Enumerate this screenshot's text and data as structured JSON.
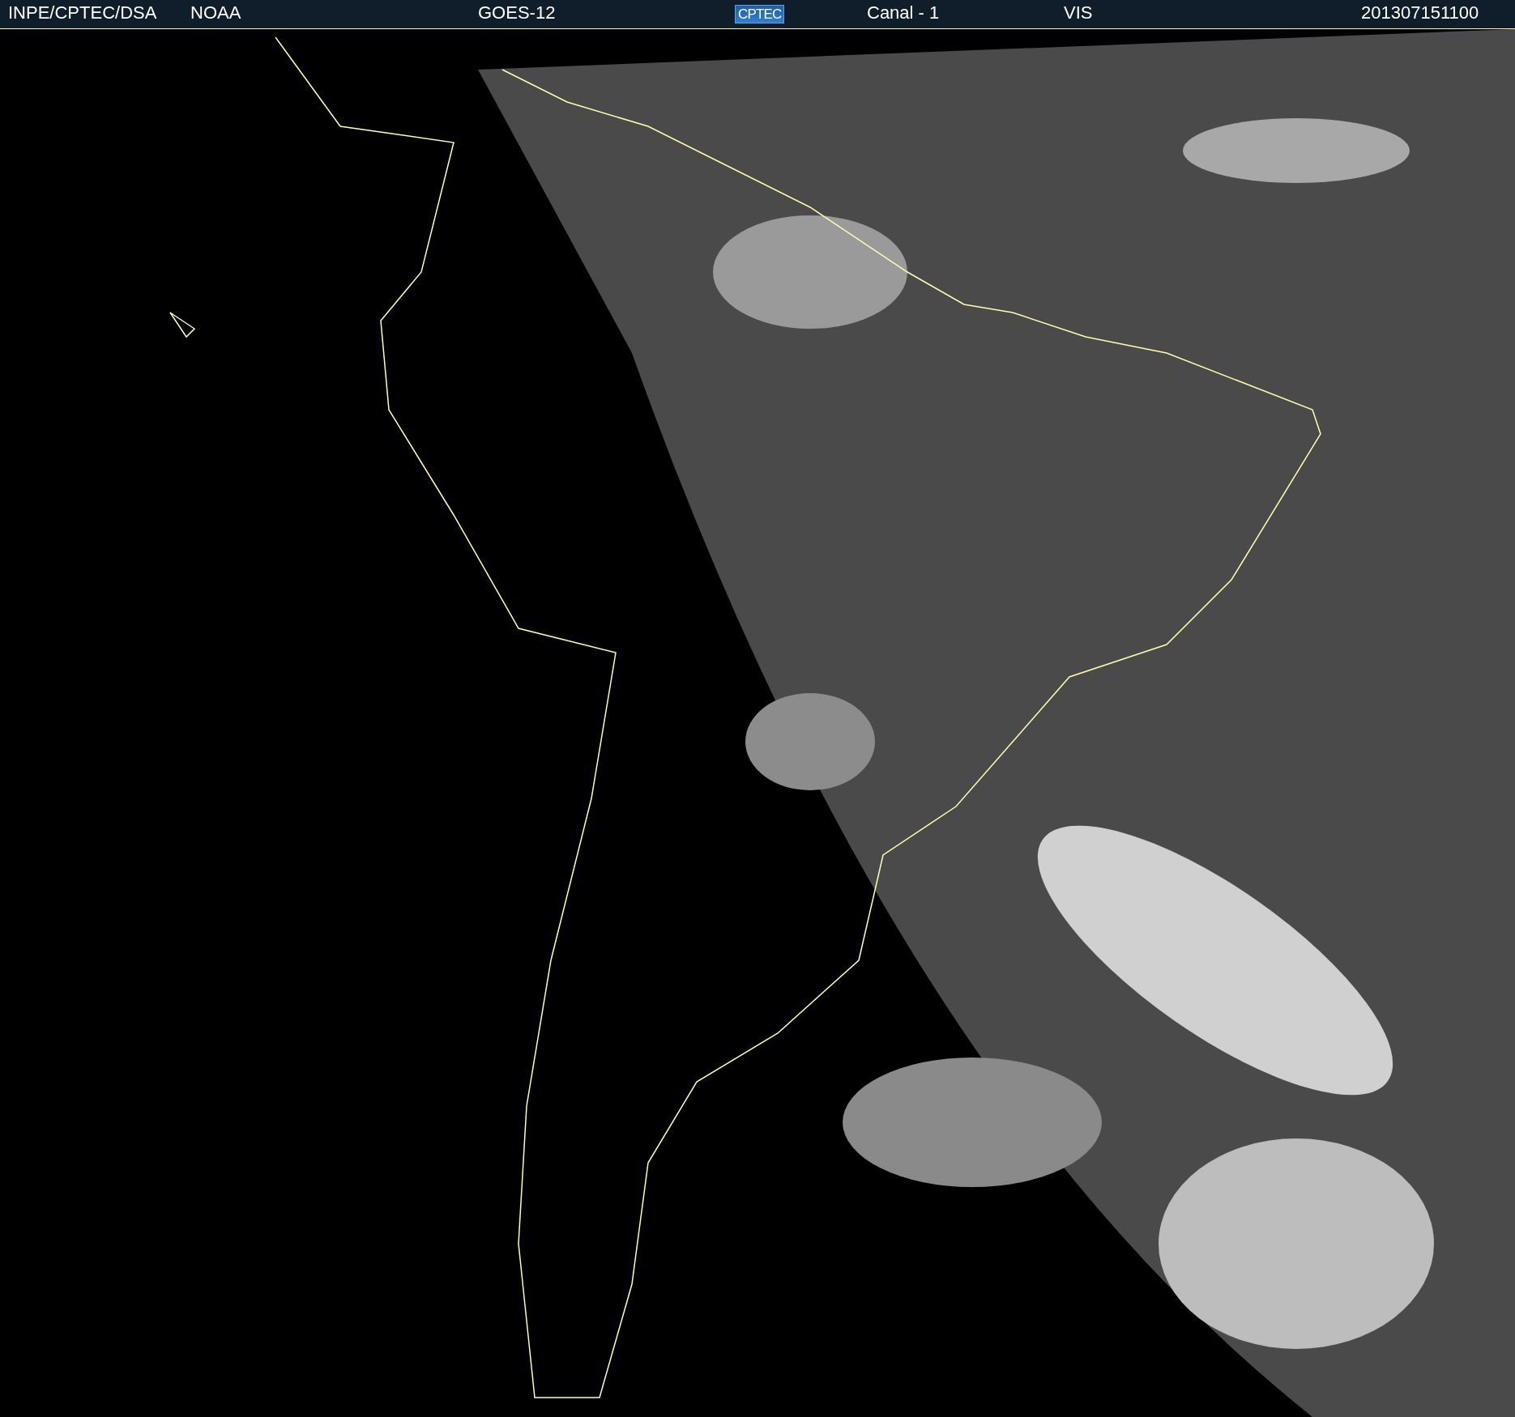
{
  "header": {
    "items": [
      {
        "kind": "text",
        "label": "INPE/CPTEC/DSA"
      },
      {
        "kind": "text",
        "label": "NOAA"
      },
      {
        "kind": "text",
        "label": "GOES-12"
      },
      {
        "kind": "logo",
        "label": "CPTEC"
      },
      {
        "kind": "text",
        "label": "Canal - 1"
      },
      {
        "kind": "text",
        "label": "VIS"
      },
      {
        "kind": "text",
        "label": "201307151100"
      }
    ]
  }
}
